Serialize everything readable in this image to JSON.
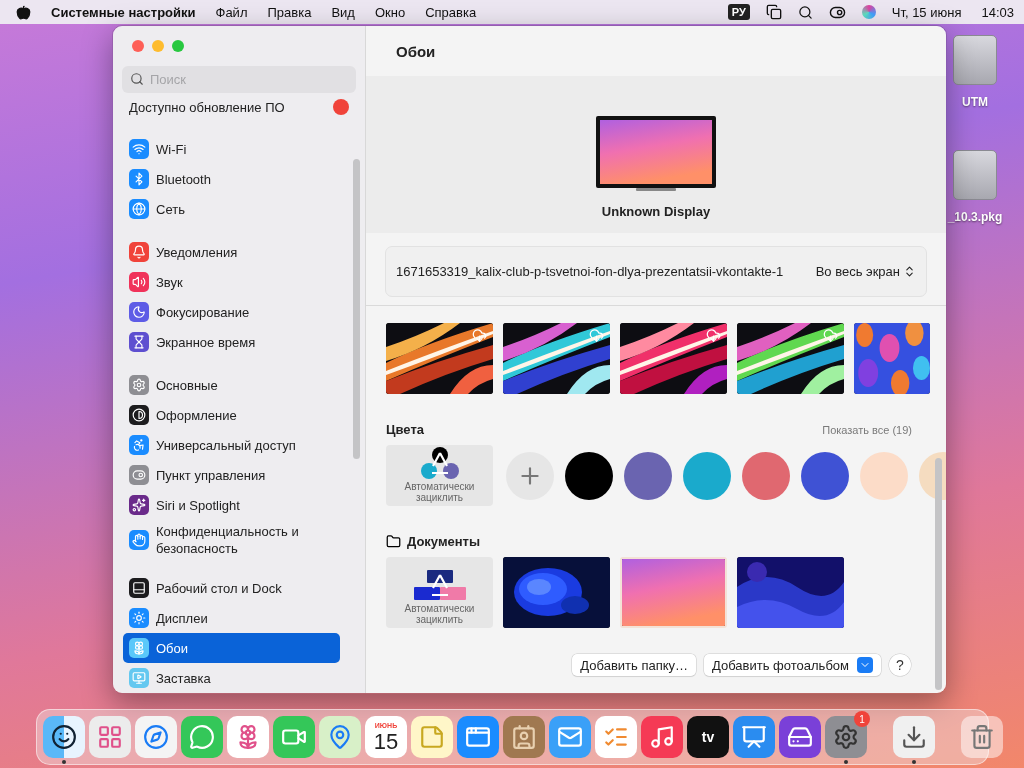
{
  "menubar": {
    "app": "Системные настройки",
    "menus": [
      "Файл",
      "Правка",
      "Вид",
      "Окно",
      "Справка"
    ],
    "input_source": "РУ",
    "date": "Чт, 15 июня",
    "time": "14:03"
  },
  "desktop_icons": [
    {
      "label": "UTM"
    },
    {
      "label": "_10.3.pkg"
    }
  ],
  "sidebar": {
    "search": {
      "placeholder": "Поиск"
    },
    "update": {
      "label": "Доступно обновление ПО"
    },
    "groups": [
      {
        "items": [
          {
            "label": "Wi-Fi",
            "selected": false,
            "color": "#1a8cff"
          },
          {
            "label": "Bluetooth",
            "selected": false,
            "color": "#1a8cff"
          },
          {
            "label": "Сеть",
            "selected": false,
            "color": "#1a8cff"
          }
        ]
      },
      {
        "items": [
          {
            "label": "Уведомления",
            "selected": false,
            "color": "#f0433a"
          },
          {
            "label": "Звук",
            "selected": false,
            "color": "#f0325a"
          },
          {
            "label": "Фокусирование",
            "selected": false,
            "color": "#5e5ce6"
          },
          {
            "label": "Экранное время",
            "selected": false,
            "color": "#5e4fd0"
          }
        ]
      },
      {
        "items": [
          {
            "label": "Основные",
            "selected": false,
            "color": "#8e8e93"
          },
          {
            "label": "Оформление",
            "selected": false,
            "color": "#1c1c1e"
          },
          {
            "label": "Универсальный доступ",
            "selected": false,
            "color": "#1a8cff"
          },
          {
            "label": "Пункт управления",
            "selected": false,
            "color": "#8e8e93"
          },
          {
            "label": "Siri и Spotlight",
            "selected": false,
            "color": "#6a2a8a"
          },
          {
            "label": "Конфиденциальность и безопасность",
            "selected": false,
            "color": "#1a8cff"
          }
        ]
      },
      {
        "items": [
          {
            "label": "Рабочий стол и Dock",
            "selected": false,
            "color": "#1c1c1e"
          },
          {
            "label": "Дисплеи",
            "selected": false,
            "color": "#1a8cff"
          },
          {
            "label": "Обои",
            "selected": true,
            "color": "#5ac8fa"
          },
          {
            "label": "Заставка",
            "selected": false,
            "color": "#64c8f0"
          }
        ]
      }
    ]
  },
  "wallpaper": {
    "title": "Обои",
    "display": "Unknown Display",
    "current": {
      "name": "1671653319_kalix-club-p-tsvetnoi-fon-dlya-prezentatsii-vkontakte-1",
      "fit": "Во весь экран"
    },
    "dynamic": [
      {
        "kind": "picture",
        "downloadable": true,
        "selected": false
      },
      {
        "kind": "picture",
        "downloadable": true,
        "selected": false
      },
      {
        "kind": "picture",
        "downloadable": true,
        "selected": false
      },
      {
        "kind": "picture",
        "downloadable": true,
        "selected": false
      },
      {
        "kind": "picture",
        "downloadable": false,
        "selected": false
      }
    ],
    "colors": {
      "title": "Цвета",
      "show_all": "Показать все (19)",
      "auto": "Автоматически зациклить",
      "items": [
        {
          "color": "#000000",
          "selected": false
        },
        {
          "color": "#6a64b0",
          "selected": false
        },
        {
          "color": "#1aaacc",
          "selected": false
        },
        {
          "color": "#e06870",
          "selected": false
        },
        {
          "color": "#3f52d4",
          "selected": false
        },
        {
          "color": "#fcdcc8",
          "selected": false
        },
        {
          "color": "#f5dcc0",
          "selected": false
        }
      ]
    },
    "documents": {
      "title": "Документы",
      "auto": "Автоматически зациклить",
      "items": [
        {
          "kind": "picture",
          "selected": false
        },
        {
          "kind": "picture",
          "selected": true
        },
        {
          "kind": "picture",
          "selected": false
        }
      ]
    },
    "buttons": {
      "add_folder": "Добавить папку…",
      "add_album": "Добавить фотоальбом",
      "help": "?"
    }
  },
  "dock": {
    "apps": [
      {
        "kind": "finder",
        "running": true
      },
      {
        "kind": "launchpad",
        "running": false
      },
      {
        "kind": "safari",
        "running": false
      },
      {
        "kind": "messages",
        "running": false
      },
      {
        "kind": "photos",
        "running": false
      },
      {
        "kind": "facetime",
        "running": false
      },
      {
        "kind": "maps",
        "running": false
      },
      {
        "kind": "calendar",
        "running": false,
        "month": "ИЮНЬ",
        "day": "15"
      },
      {
        "kind": "notes",
        "running": false
      },
      {
        "kind": "appstore",
        "running": false
      },
      {
        "kind": "contacts",
        "running": false
      },
      {
        "kind": "mail",
        "running": false
      },
      {
        "kind": "reminders",
        "running": false
      },
      {
        "kind": "music",
        "running": false
      },
      {
        "kind": "tv",
        "running": false,
        "label": "tv"
      },
      {
        "kind": "keynote",
        "running": false
      },
      {
        "kind": "drive",
        "running": false
      },
      {
        "kind": "settings",
        "running": true,
        "badge": "1"
      }
    ],
    "folders": [
      {
        "kind": "downloads",
        "running": true
      }
    ],
    "trash": {
      "kind": "trash",
      "running": false
    }
  }
}
